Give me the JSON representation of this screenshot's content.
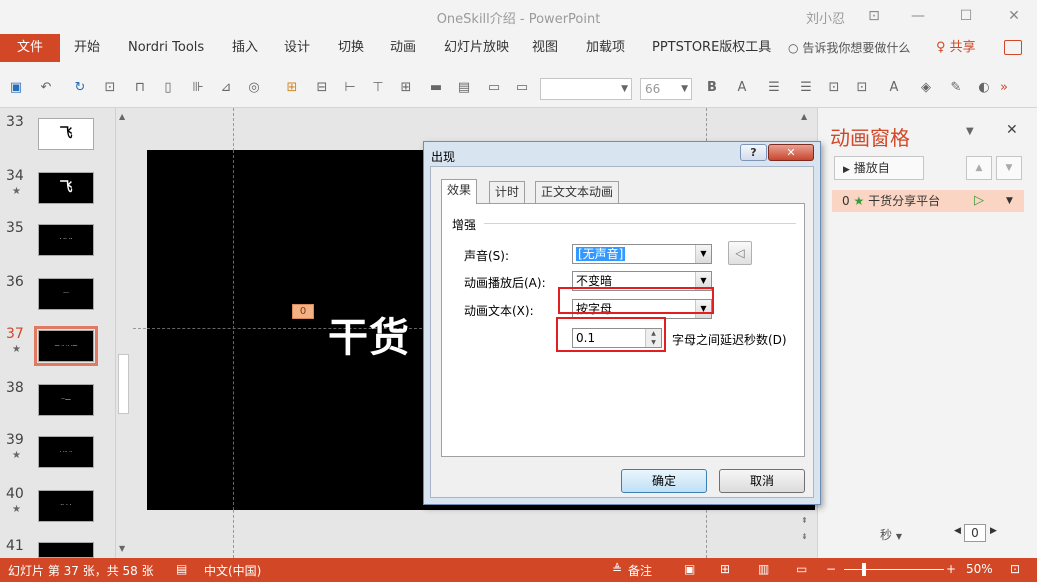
{
  "window": {
    "title": "OneSkill介绍 - PowerPoint",
    "user": "刘小忍",
    "controls": {
      "ribbon": "⊡",
      "minimize": "—",
      "maximize": "☐",
      "close": "✕"
    }
  },
  "ribbon_tabs": [
    "文件",
    "开始",
    "Nordri Tools",
    "插入",
    "设计",
    "切换",
    "动画",
    "幻灯片放映",
    "视图",
    "加载项",
    "PPTSTORE版权工具"
  ],
  "tell_me": "告诉我你想要做什么",
  "share": "共享",
  "toolbar": {
    "font_name": "",
    "font_size": "66",
    "icons": [
      "save-icon",
      "undo-icon",
      "redo-icon",
      "bold-icon",
      "font-color-icon",
      "align-icon",
      "more-icon"
    ]
  },
  "slides": [
    {
      "num": "33",
      "star": false,
      "thumb": "飞",
      "white": true
    },
    {
      "num": "34",
      "star": true,
      "thumb": "飞",
      "white": false
    },
    {
      "num": "35",
      "star": false,
      "thumb": "· ·· ··",
      "white": false
    },
    {
      "num": "36",
      "star": false,
      "thumb": "···",
      "white": false
    },
    {
      "num": "37",
      "star": true,
      "thumb": "— ·· ·· ·—",
      "white": false,
      "active": true
    },
    {
      "num": "38",
      "star": false,
      "thumb": "··—",
      "white": false
    },
    {
      "num": "39",
      "star": true,
      "thumb": "· ··· ··",
      "white": false
    },
    {
      "num": "40",
      "star": true,
      "thumb": "·· · ·",
      "white": false
    },
    {
      "num": "41",
      "star": true,
      "thumb": "",
      "white": false
    }
  ],
  "slide": {
    "text": "干货",
    "anim_tag": "0"
  },
  "anim_pane": {
    "title": "动画窗格",
    "play_label": "播放自",
    "item_index": "0",
    "item_name": "干货分享平台",
    "time_unit": "秒",
    "zoom_value": "0"
  },
  "dialog": {
    "title": "出现",
    "help": "?",
    "close": "✕",
    "tabs": [
      "效果",
      "计时",
      "正文文本动画"
    ],
    "group": "增强",
    "sound_label": "声音(S):",
    "sound_value": "[无声音]",
    "after_label": "动画播放后(A):",
    "after_value": "不变暗",
    "text_label": "动画文本(X):",
    "text_value": "按字母",
    "delay_value": "0.1",
    "delay_label": "字母之间延迟秒数(D)",
    "ok": "确定",
    "cancel": "取消"
  },
  "status": {
    "slide_info": "幻灯片 第 37 张，共 58 张",
    "language": "中文(中国)",
    "notes": "备注",
    "zoom": "50%"
  },
  "colors": {
    "accent": "#d24726",
    "highlight": "#e02020"
  }
}
